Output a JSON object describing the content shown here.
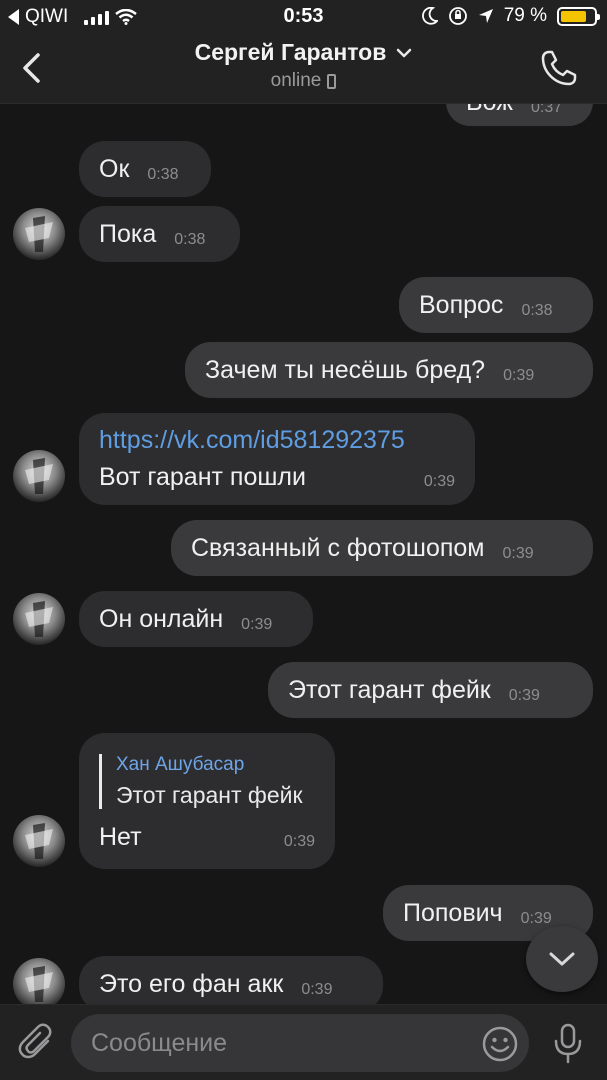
{
  "status_bar": {
    "carrier": "QIWI",
    "time": "0:53",
    "battery": "79 %",
    "battery_level": 0.79,
    "battery_color": "#f5c400"
  },
  "header": {
    "title": "Сергей Гарантов",
    "subtitle": "online",
    "icons": [
      "back-chevron-icon",
      "chevron-down-icon",
      "phone-icon",
      "mobile-icon"
    ]
  },
  "messages": [
    {
      "dir": "out",
      "text": "Вож",
      "time": "0:37"
    },
    {
      "dir": "in",
      "text": "Ок",
      "time": "0:38"
    },
    {
      "dir": "in",
      "text": "Пока",
      "time": "0:38"
    },
    {
      "dir": "out",
      "text": "Вопрос",
      "time": "0:38"
    },
    {
      "dir": "out",
      "text": "Зачем ты несёшь бред?",
      "time": "0:39"
    },
    {
      "dir": "in",
      "link": "https://vk.com/id581292375",
      "text": "Вот гарант пошли",
      "time": "0:39"
    },
    {
      "dir": "out",
      "text": "Связанный с фотошопом",
      "time": "0:39"
    },
    {
      "dir": "in",
      "text": "Он онлайн",
      "time": "0:39"
    },
    {
      "dir": "out",
      "text": "Этот гарант фейк",
      "time": "0:39"
    },
    {
      "dir": "in",
      "reply_name": "Хан Ашубасар",
      "reply_text": "Этот гарант фейк",
      "text": "Нет",
      "time": "0:39"
    },
    {
      "dir": "out",
      "text": "Попович",
      "time": "0:39"
    },
    {
      "dir": "in",
      "text": "Это его фан акк",
      "time": "0:39"
    }
  ],
  "composer": {
    "placeholder": "Сообщение"
  },
  "colors": {
    "background": "#161616",
    "bar": "#222222",
    "bubble_in": "#2d2d2f",
    "bubble_out": "#3a3a3c",
    "link": "#5f9de3",
    "reply_name": "#6ea5e8"
  }
}
